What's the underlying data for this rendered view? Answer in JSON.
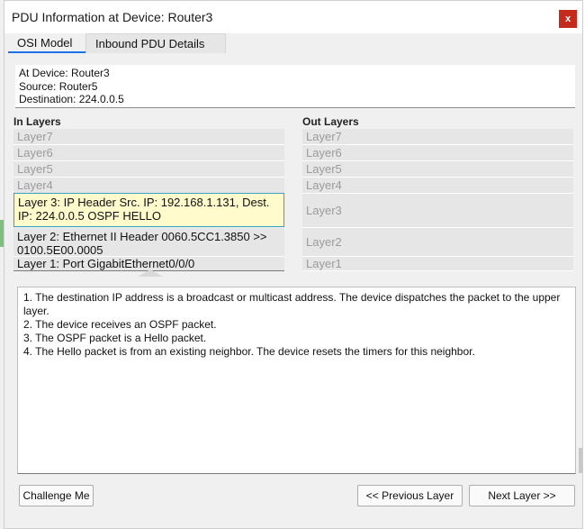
{
  "window": {
    "title": "PDU Information at Device: Router3",
    "close_label": "x"
  },
  "tabs": [
    {
      "label": "OSI Model",
      "active": true
    },
    {
      "label": "Inbound PDU Details",
      "active": false
    }
  ],
  "info": {
    "lines": [
      "At Device: Router3",
      "Source: Router5",
      "Destination: 224.0.0.5"
    ]
  },
  "in_layers": {
    "label": "In Layers",
    "items": [
      {
        "text": "Layer7",
        "active": false
      },
      {
        "text": "Layer6",
        "active": false
      },
      {
        "text": "Layer5",
        "active": false
      },
      {
        "text": "Layer4",
        "active": false
      },
      {
        "text": "Layer 3: IP Header Src. IP: 192.168.1.131, Dest. IP: 224.0.0.5 OSPF HELLO",
        "active": true,
        "selected": true
      },
      {
        "text": "Layer 2: Ethernet II Header 0060.5CC1.3850 >> 0100.5E00.0005",
        "active": true
      },
      {
        "text": "Layer 1: Port GigabitEthernet0/0/0",
        "active": true
      }
    ]
  },
  "out_layers": {
    "label": "Out Layers",
    "items": [
      {
        "text": "Layer7"
      },
      {
        "text": "Layer6"
      },
      {
        "text": "Layer5"
      },
      {
        "text": "Layer4"
      },
      {
        "text": "Layer3"
      },
      {
        "text": "Layer2"
      },
      {
        "text": "Layer1"
      }
    ]
  },
  "description": {
    "lines": [
      "1. The destination IP address is a broadcast or multicast address. The device dispatches the packet to the upper layer.",
      "2. The device receives an OSPF packet.",
      "3. The OSPF packet is a Hello packet.",
      "4. The Hello packet is from an existing neighbor. The device resets the timers for this neighbor."
    ]
  },
  "buttons": {
    "challenge": "Challenge Me",
    "prev": "<< Previous Layer",
    "next": "Next Layer >>"
  },
  "colors": {
    "close": "#c42b1c",
    "selected_bg": "#fffbcc",
    "selected_border": "#37a0c6",
    "tab_accent": "#1a73e8"
  }
}
